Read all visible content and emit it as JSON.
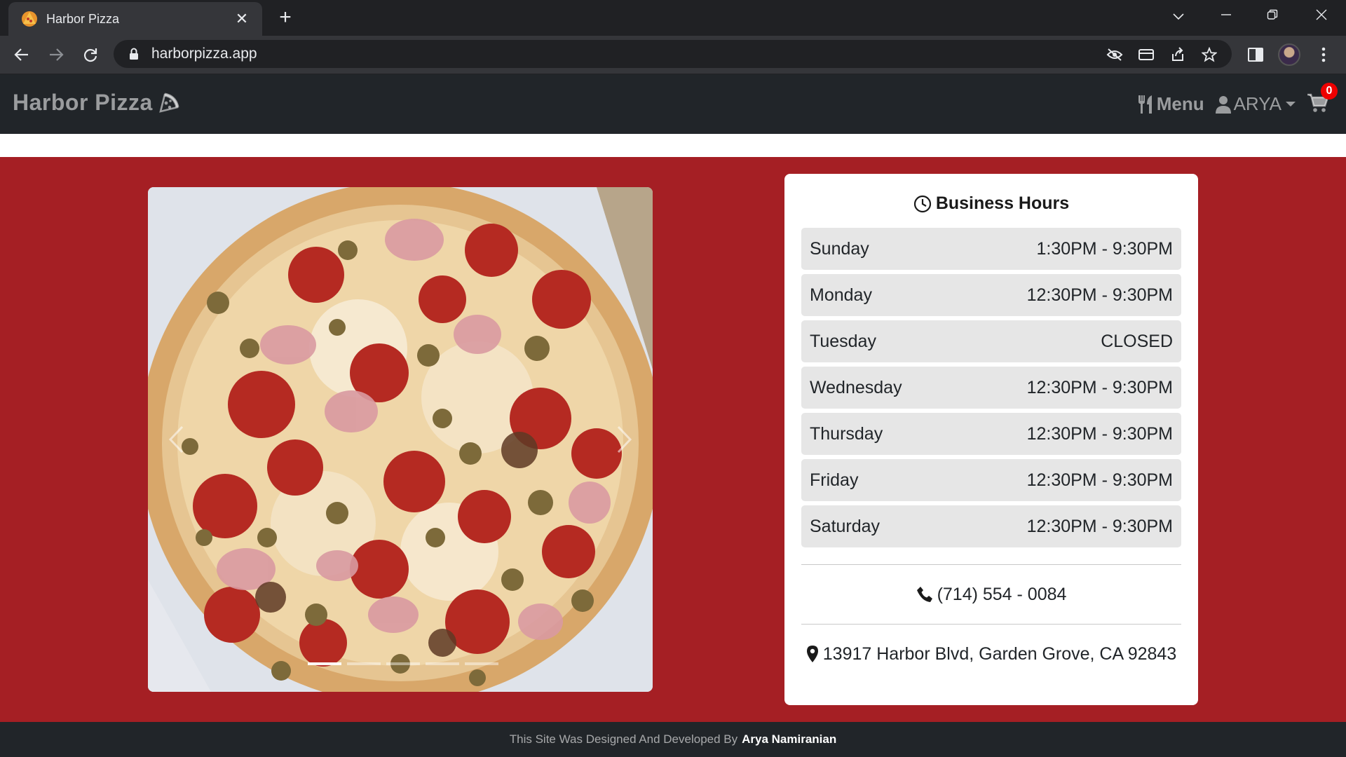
{
  "browser": {
    "tab_title": "Harbor Pizza",
    "url": "harborpizza.app",
    "icons": [
      "favicon-pizza",
      "tab-close-icon",
      "new-tab-icon",
      "tab-search-icon",
      "minimize-icon",
      "restore-icon",
      "window-close-icon",
      "back-icon",
      "forward-icon",
      "reload-icon",
      "lock-icon",
      "eye-off-icon",
      "card-icon",
      "share-icon",
      "star-icon",
      "side-panel-icon",
      "kebab-icon"
    ]
  },
  "navbar": {
    "brand": "Harbor Pizza",
    "menu_label": "Menu",
    "user_label": "ARYA",
    "cart_count": "0"
  },
  "hours": {
    "title": "Business Hours",
    "rows": [
      {
        "day": "Sunday",
        "time": "1:30PM - 9:30PM"
      },
      {
        "day": "Monday",
        "time": "12:30PM - 9:30PM"
      },
      {
        "day": "Tuesday",
        "time": "CLOSED"
      },
      {
        "day": "Wednesday",
        "time": "12:30PM - 9:30PM"
      },
      {
        "day": "Thursday",
        "time": "12:30PM - 9:30PM"
      },
      {
        "day": "Friday",
        "time": "12:30PM - 9:30PM"
      },
      {
        "day": "Saturday",
        "time": "12:30PM - 9:30PM"
      }
    ],
    "phone": "(714) 554 - 0084",
    "address": "13917 Harbor Blvd, Garden Grove, CA 92843"
  },
  "footer": {
    "prefix": "This Site Was Designed And Developed By",
    "author": "Arya Namiranian"
  },
  "carousel": {
    "slide_count": 5,
    "active_index": 0
  },
  "colors": {
    "hero_red": "#a51f24",
    "nav_dark": "#212529",
    "badge_red": "#ee0000"
  }
}
